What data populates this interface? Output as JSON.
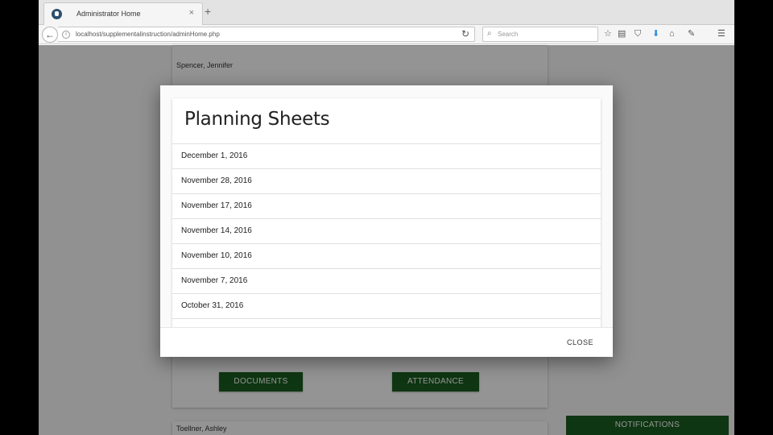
{
  "browser": {
    "tab_title": "Administrator Home",
    "tab_close": "×",
    "new_tab": "+",
    "back": "←",
    "info": "i",
    "url": "localhost/supplementalinstruction/adminHome.php",
    "reload": "↻",
    "search_placeholder": "Search",
    "search_icon": "⌕",
    "toolbar_icons": {
      "bookmark_star": "☆",
      "reading_list": "▤",
      "pocket": "⛉",
      "download": "⬇",
      "home": "⌂",
      "extension": "✎",
      "menu": "☰"
    }
  },
  "page": {
    "cards": [
      {
        "name": "Spencer, Jennifer"
      },
      {
        "name": "Toellner, Ashley"
      }
    ],
    "documents_label": "DOCUMENTS",
    "attendance_label": "ATTENDANCE",
    "notifications_label": "NOTIFICATIONS"
  },
  "modal": {
    "title": "Planning Sheets",
    "items": [
      "December 1, 2016",
      "November 28, 2016",
      "November 17, 2016",
      "November 14, 2016",
      "November 10, 2016",
      "November 7, 2016",
      "October 31, 2016"
    ],
    "close_label": "CLOSE"
  },
  "colors": {
    "accent_green": "#1b5e20",
    "download_blue": "#2f8fe0"
  }
}
